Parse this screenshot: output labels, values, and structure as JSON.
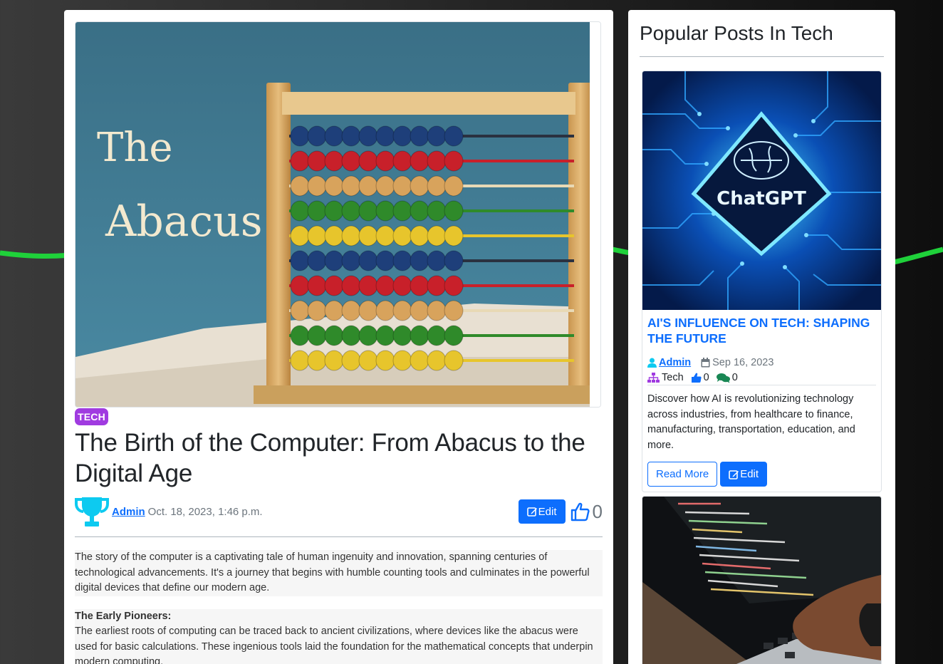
{
  "post": {
    "category_badge": "TECH",
    "title": "The Birth of the Computer: From Abacus to the Digital Age",
    "author": "Admin",
    "date": "Oct. 18, 2023, 1:46 p.m.",
    "edit_label": "Edit",
    "like_count": "0",
    "hero_text_line1": "The",
    "hero_text_line2": "Abacus",
    "paragraphs": [
      "The story of the computer is a captivating tale of human ingenuity and innovation, spanning centuries of technological advancements. It's a journey that begins with humble counting tools and culminates in the powerful digital devices that define our modern age."
    ],
    "section": {
      "heading": "The Early Pioneers:",
      "text": "The earliest roots of computing can be traced back to ancient civilizations, where devices like the abacus were used for basic calculations. These ingenious tools laid the foundation for the mathematical concepts that underpin modern computing."
    }
  },
  "sidebar": {
    "title": "Popular Posts In Tech",
    "posts": [
      {
        "image_label": "ChatGPT",
        "title": "AI's Influence on Tech: Shaping the Future",
        "author": "Admin",
        "date": "Sep 16, 2023",
        "category": "Tech",
        "likes": "0",
        "comments": "0",
        "excerpt": "Discover how AI is revolutionizing technology across industries, from healthcare to finance, manufacturing, transportation, education, and more.",
        "read_more": "Read More",
        "edit_label": "Edit"
      }
    ]
  },
  "colors": {
    "primary": "#0d6efd",
    "badge": "#a03be0",
    "trophy": "#0dcaf0",
    "wave": "#1fd13a"
  },
  "icons": [
    "trophy-icon",
    "edit-icon",
    "thumbs-up-icon",
    "user-icon",
    "calendar-icon",
    "sitemap-icon",
    "comments-icon"
  ]
}
